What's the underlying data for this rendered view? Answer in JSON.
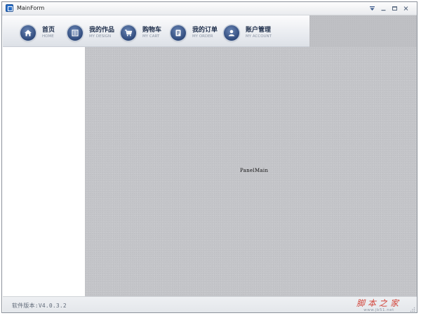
{
  "window": {
    "title": "MainForm",
    "controls": [
      "options",
      "minimize",
      "maximize",
      "close"
    ]
  },
  "nav": {
    "items": [
      {
        "label": "首页",
        "sublabel": "HOME",
        "icon": "home-icon"
      },
      {
        "label": "我的作品",
        "sublabel": "MY DESIGN",
        "icon": "design-icon"
      },
      {
        "label": "购物车",
        "sublabel": "MY CART",
        "icon": "cart-icon"
      },
      {
        "label": "我的订单",
        "sublabel": "MY ORDER",
        "icon": "order-icon"
      },
      {
        "label": "账户管理",
        "sublabel": "MY ACCOUNT",
        "icon": "account-icon"
      }
    ]
  },
  "main": {
    "panel_label": "PanelMain"
  },
  "status": {
    "version": "软件版本:V4.0.3.2"
  },
  "watermark": {
    "text": "脚本之家",
    "url": "www.jb51.net"
  },
  "colors": {
    "accent": "#2f4a7c",
    "panel_bg": "#c4c5c9",
    "watermark": "#d2463c"
  }
}
